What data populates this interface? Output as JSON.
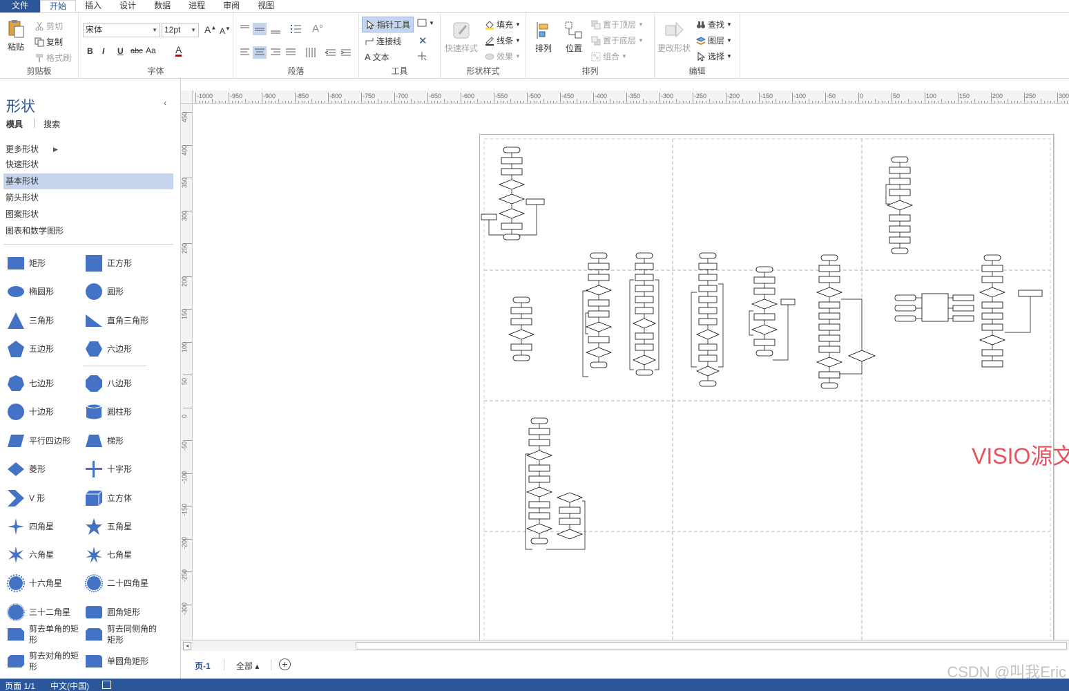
{
  "menu": {
    "tabs": [
      {
        "label": "文件"
      },
      {
        "label": "开始"
      },
      {
        "label": "插入"
      },
      {
        "label": "设计"
      },
      {
        "label": "数据"
      },
      {
        "label": "进程"
      },
      {
        "label": "审阅"
      },
      {
        "label": "视图"
      }
    ]
  },
  "ribbon": {
    "clipboard": {
      "label": "剪贴板",
      "paste": "粘贴",
      "cut": "剪切",
      "copy": "复制",
      "format_painter": "格式刷"
    },
    "font": {
      "label": "字体",
      "family": "宋体",
      "size": "12pt",
      "bold": "B",
      "italic": "I",
      "underline": "U",
      "strike": "abc",
      "case": "Aa",
      "color_glyph": "A"
    },
    "paragraph": {
      "label": "段落"
    },
    "tools": {
      "label": "工具",
      "pointer": "指针工具",
      "connector": "连接线",
      "text": "文本"
    },
    "shape_styles": {
      "label": "形状样式",
      "quick_styles": "快速样式",
      "fill": "填充",
      "line": "线条",
      "effects": "效果"
    },
    "arrange": {
      "label": "排列",
      "arrange_btn": "排列",
      "position": "位置",
      "bring_front": "置于顶层",
      "send_back": "置于底层",
      "group": "组合"
    },
    "editing": {
      "label": "编辑",
      "change_shape": "更改形状",
      "find": "查找",
      "layers": "图层",
      "select": "选择"
    }
  },
  "shapes_pane": {
    "title": "形状",
    "collapse_glyph": "‹",
    "tab_stencils": "模具",
    "tab_search": "搜索",
    "stencils": [
      {
        "label": "更多形状"
      },
      {
        "label": "快速形状"
      },
      {
        "label": "基本形状"
      },
      {
        "label": "箭头形状"
      },
      {
        "label": "图案形状"
      },
      {
        "label": "图表和数学图形"
      }
    ],
    "more_arrow": "▶",
    "shapes": [
      {
        "label": "矩形",
        "icon": "rectangle-icon"
      },
      {
        "label": "正方形",
        "icon": "square-icon"
      },
      {
        "label": "椭圆形",
        "icon": "ellipse-icon"
      },
      {
        "label": "圆形",
        "icon": "circle-icon"
      },
      {
        "label": "三角形",
        "icon": "triangle-icon"
      },
      {
        "label": "直角三角形",
        "icon": "right-triangle-icon"
      },
      {
        "label": "五边形",
        "icon": "pentagon-icon"
      },
      {
        "label": "六边形",
        "icon": "hexagon-icon"
      },
      {
        "label": "七边形",
        "icon": "heptagon-icon"
      },
      {
        "label": "八边形",
        "icon": "octagon-icon"
      },
      {
        "label": "十边形",
        "icon": "decagon-icon"
      },
      {
        "label": "圆柱形",
        "icon": "cylinder-icon"
      },
      {
        "label": "平行四边形",
        "icon": "parallelogram-icon"
      },
      {
        "label": "梯形",
        "icon": "trapezoid-icon"
      },
      {
        "label": "菱形",
        "icon": "diamond-icon"
      },
      {
        "label": "十字形",
        "icon": "cross-icon"
      },
      {
        "label": "V 形",
        "icon": "chevron-icon"
      },
      {
        "label": "立方体",
        "icon": "cube-icon"
      },
      {
        "label": "四角星",
        "icon": "star4-icon"
      },
      {
        "label": "五角星",
        "icon": "star5-icon"
      },
      {
        "label": "六角星",
        "icon": "star6-icon"
      },
      {
        "label": "七角星",
        "icon": "star7-icon"
      },
      {
        "label": "十六角星",
        "icon": "star16-icon"
      },
      {
        "label": "二十四角星",
        "icon": "star24-icon"
      },
      {
        "label": "三十二角星",
        "icon": "star32-icon"
      },
      {
        "label": "圆角矩形",
        "icon": "rounded-rectangle-icon"
      },
      {
        "label": "剪去单角的矩形",
        "icon": "snip-single-corner-icon"
      },
      {
        "label": "剪去同侧角的矩形",
        "icon": "snip-same-side-icon"
      },
      {
        "label": "剪去对角的矩形",
        "icon": "snip-diagonal-icon"
      },
      {
        "label": "单圆角矩形",
        "icon": "round-single-corner-icon"
      }
    ]
  },
  "ruler": {
    "top_labels": [
      "-1000",
      "-950",
      "-900",
      "-850",
      "-800",
      "-750",
      "-700",
      "-650",
      "-600",
      "-550",
      "-500",
      "-450",
      "-400",
      "-350",
      "-300",
      "-250",
      "-200",
      "-150",
      "-100",
      "-50",
      "0",
      "50",
      "100",
      "150",
      "200",
      "250",
      "300"
    ],
    "left_labels": [
      "450",
      "400",
      "350",
      "300",
      "250",
      "200",
      "150",
      "100",
      "50",
      "0",
      "-50",
      "-100",
      "-150",
      "-200",
      "-250",
      "-300"
    ]
  },
  "canvas": {
    "overlay_text": "VISIO源文件",
    "overlay_color": "#e8505b"
  },
  "page_tabs": {
    "current": "页-1",
    "all": "全部 ▴",
    "add_glyph": "+"
  },
  "status": {
    "page": "页面 1/1",
    "language": "中文(中国)"
  },
  "watermark": "CSDN @叫我Eric",
  "colors": {
    "accent": "#2b579a",
    "shape_fill": "#4472c4",
    "selected_bg": "#c5d5ee"
  }
}
